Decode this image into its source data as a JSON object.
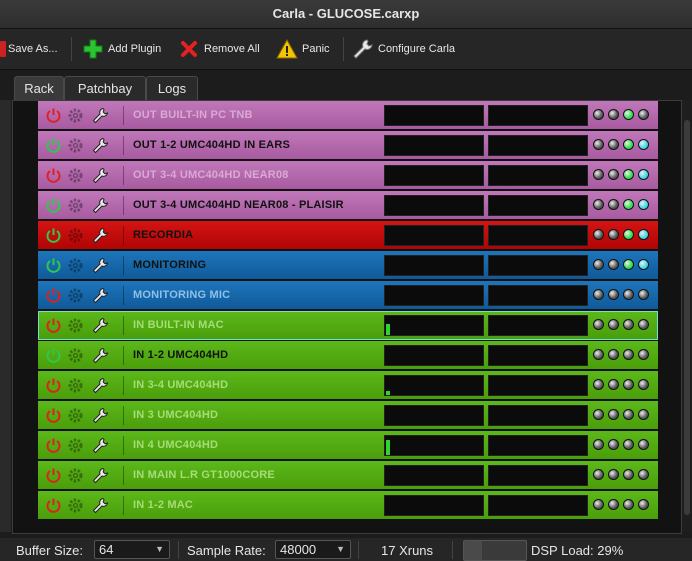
{
  "window": {
    "title": "Carla - GLUCOSE.carxp"
  },
  "toolbar": {
    "save_as": "Save As...",
    "add_plugin": "Add Plugin",
    "remove_all": "Remove All",
    "panic": "Panic",
    "configure": "Configure Carla"
  },
  "tabs": [
    {
      "label": "Rack",
      "active": true
    },
    {
      "label": "Patchbay",
      "active": false
    },
    {
      "label": "Logs",
      "active": false
    }
  ],
  "colors": {
    "pink": "#b565ad",
    "red": "#c80a0a",
    "blue": "#1568ad",
    "green": "#52ac0e",
    "selected_border": "#6fe0d8"
  },
  "rack": [
    {
      "name": "OUT BUILT-IN PC TNB",
      "color": "pink",
      "enabled": false,
      "meter1": 0,
      "meter2": 0,
      "leds": [
        0,
        0,
        1,
        0
      ]
    },
    {
      "name": "OUT 1-2 UMC404HD IN EARS",
      "color": "pink",
      "enabled": true,
      "meter1": 0,
      "meter2": 0,
      "leds": [
        0,
        0,
        1,
        2
      ]
    },
    {
      "name": "OUT 3-4 UMC404HD NEAR08",
      "color": "pink",
      "enabled": false,
      "meter1": 0,
      "meter2": 0,
      "leds": [
        0,
        0,
        1,
        2
      ]
    },
    {
      "name": "OUT 3-4 UMC404HD NEAR08 - PLAISIR",
      "color": "pink",
      "enabled": true,
      "meter1": 0,
      "meter2": 0,
      "leds": [
        0,
        0,
        1,
        2
      ]
    },
    {
      "name": "RECORDIA",
      "color": "red",
      "enabled": true,
      "meter1": 0,
      "meter2": 0,
      "leds": [
        0,
        0,
        1,
        2
      ]
    },
    {
      "name": "MONITORING",
      "color": "blue",
      "enabled": true,
      "meter1": 0,
      "meter2": 0,
      "leds": [
        0,
        0,
        1,
        2
      ]
    },
    {
      "name": "MONITORING MIC",
      "color": "blue",
      "enabled": false,
      "meter1": 0,
      "meter2": 0,
      "leds": [
        0,
        0,
        0,
        0
      ]
    },
    {
      "name": "IN BUILT-IN MAC",
      "color": "green",
      "enabled": false,
      "selected": true,
      "meter1": 0.6,
      "meter2": 0,
      "leds": [
        0,
        0,
        0,
        0
      ]
    },
    {
      "name": "IN 1-2 UMC404HD",
      "color": "green",
      "enabled": true,
      "meter1": 0,
      "meter2": 0,
      "leds": [
        0,
        0,
        0,
        0
      ]
    },
    {
      "name": "IN 3-4 UMC404HD",
      "color": "green",
      "enabled": false,
      "meter1": 0.2,
      "meter2": 0,
      "leds": [
        0,
        0,
        0,
        0
      ]
    },
    {
      "name": "IN 3 UMC404HD",
      "color": "green",
      "enabled": false,
      "meter1": 0,
      "meter2": 0,
      "leds": [
        0,
        0,
        0,
        0
      ]
    },
    {
      "name": "IN 4 UMC404HD",
      "color": "green",
      "enabled": false,
      "meter1": 0.8,
      "meter2": 0,
      "leds": [
        0,
        0,
        0,
        0
      ]
    },
    {
      "name": "IN MAIN L.R GT1000CORE",
      "color": "green",
      "enabled": false,
      "meter1": 0,
      "meter2": 0,
      "leds": [
        0,
        0,
        0,
        0
      ]
    },
    {
      "name": "IN 1-2 MAC",
      "color": "green",
      "enabled": false,
      "meter1": 0,
      "meter2": 0,
      "leds": [
        0,
        0,
        0,
        0
      ]
    }
  ],
  "status": {
    "buffer_label": "Buffer Size:",
    "buffer_value": "64",
    "rate_label": "Sample Rate:",
    "rate_value": "48000",
    "xruns": "17 Xruns",
    "dsp_label": "DSP Load: 29%",
    "dsp_fraction": 0.29
  }
}
